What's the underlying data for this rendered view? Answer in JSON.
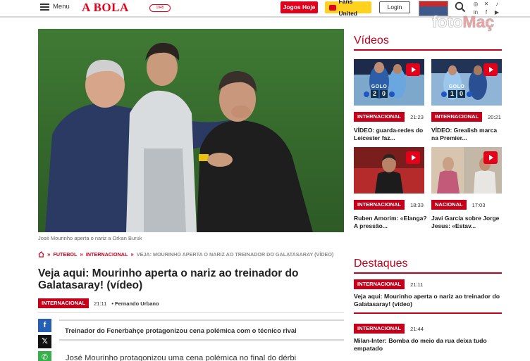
{
  "header": {
    "menu_label": "Menu",
    "logo_text": "A BOLA",
    "logo_badge": "1945",
    "jogos_hoje": "Jogos Hoje",
    "fans_united": "Fans United",
    "login": "Login",
    "social_icons": [
      "instagram-icon",
      "x-icon",
      "tiktok-icon",
      "linkedin-icon",
      "facebook-icon",
      "youtube-icon"
    ],
    "watermark": "fotoMaç"
  },
  "article": {
    "image_caption": "José Mourinho aperta o nariz a Orkan Buruk",
    "breadcrumb": [
      "FUTEBOL",
      "INTERNACIONAL",
      "VEJA: MOURINHO APERTA O NARIZ AO TREINADOR DO GALATASARAY (VÍDEO)"
    ],
    "title": "Veja aqui: Mourinho aperta o nariz ao treinador do Galatasaray! (vídeo)",
    "category": "INTERNACIONAL",
    "time": "21:11",
    "author": "• Fernando Urbano",
    "lead": "Treinador do Fenerbahçe protagonizou cena polémica com o técnico rival",
    "body_start": "José Mourinho protagonizou uma cena polémica no final do dérbi"
  },
  "sidebar": {
    "videos_heading": "Vídeos",
    "videos": [
      {
        "category": "INTERNACIONAL",
        "time": "21:23",
        "title": "VÍDEO: guarda-redes do Leicester faz...",
        "score_label": "GOLO",
        "score": [
          "2",
          "0"
        ]
      },
      {
        "category": "INTERNACIONAL",
        "time": "20:21",
        "title": "VÍDEO: Grealish marca na Premier...",
        "score_label": "GOLO",
        "score": [
          "1",
          "0"
        ]
      },
      {
        "category": "INTERNACIONAL",
        "time": "18:33",
        "title": "Ruben Amorim: «Elanga? A pressão...",
        "score_label": "",
        "score": []
      },
      {
        "category": "NACIONAL",
        "time": "17:03",
        "title": "Javi García sobre Jorge Jesus: «Estav...",
        "score_label": "",
        "score": []
      }
    ],
    "destaques_heading": "Destaques",
    "destaques": [
      {
        "category": "INTERNACIONAL",
        "time": "21:11",
        "title": "Veja aqui: Mourinho aperta o nariz ao treinador do Galatasaray! (vídeo)"
      },
      {
        "category": "INTERNACIONAL",
        "time": "21:44",
        "title": "Milan-Inter: Bomba do meio da rua deixa tudo empatado"
      }
    ]
  },
  "share": {
    "facebook": "f",
    "x": "𝕏",
    "whatsapp": "✆"
  },
  "colors": {
    "brand_red": "#e2001a",
    "tag_red": "#c4001a",
    "fans_yellow": "#ffd21f"
  }
}
